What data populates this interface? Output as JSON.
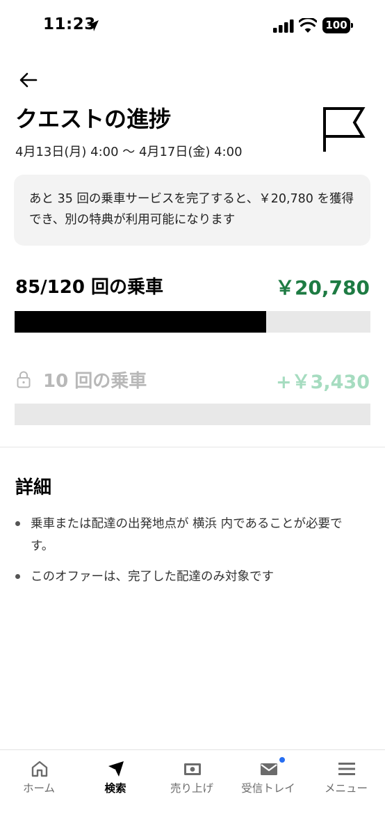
{
  "status_bar": {
    "time": "11:23",
    "battery": "100"
  },
  "header": {
    "title": "クエストの進捗",
    "date_range": "4月13日(月) 4:00 〜 4月17日(金) 4:00"
  },
  "info_card": {
    "text": "あと 35 回の乗車サービスを完了すると、￥20,780 を獲得でき、別の特典が利用可能になります"
  },
  "progress": {
    "rides_label": "85/120 回の乗車",
    "reward": "￥20,780",
    "fraction": 0.708
  },
  "locked_tier": {
    "rides_label": "10 回の乗車",
    "reward": "+￥3,430",
    "fraction": 0
  },
  "details": {
    "heading": "詳細",
    "items": [
      "乗車または配達の出発地点が 横浜 内であることが必要です。",
      "このオファーは、完了した配達のみ対象です"
    ]
  },
  "nav": {
    "items": [
      {
        "label": "ホーム",
        "icon": "home-icon"
      },
      {
        "label": "検索",
        "icon": "compass-icon"
      },
      {
        "label": "売り上げ",
        "icon": "earnings-icon"
      },
      {
        "label": "受信トレイ",
        "icon": "inbox-icon"
      },
      {
        "label": "メニュー",
        "icon": "menu-icon"
      }
    ],
    "active_index": 1
  },
  "colors": {
    "accent_green": "#1e7b43",
    "locked_green": "#a6dcc0",
    "notification_blue": "#276ef1"
  }
}
